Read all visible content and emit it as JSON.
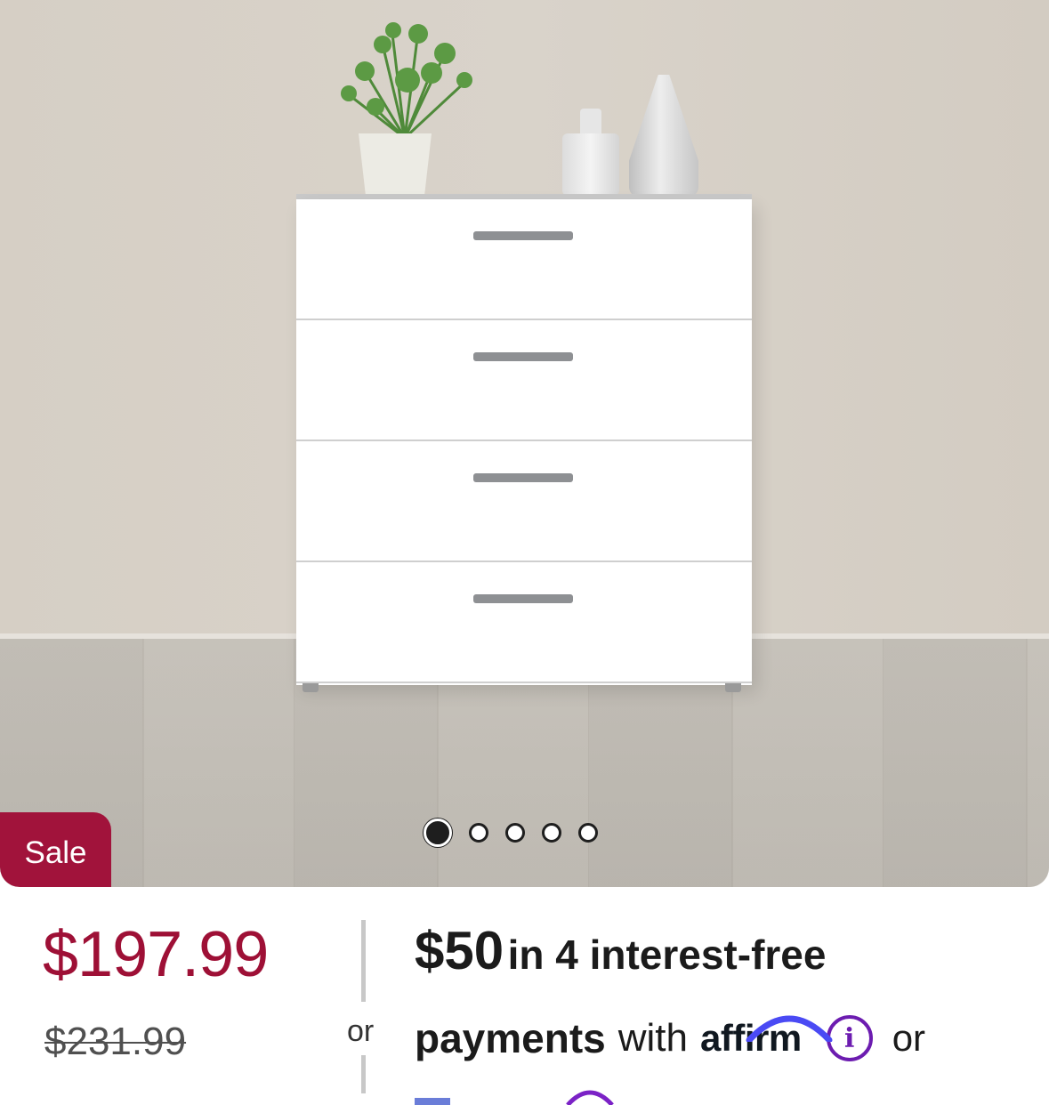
{
  "product": {
    "badge": "Sale",
    "price": "$197.99",
    "original_price": "$231.99"
  },
  "gallery": {
    "total_images": 5,
    "active_index": 0
  },
  "financing": {
    "or_separator": "or",
    "installment_amount": "$50",
    "installment_text": "in 4 interest-free",
    "payments_label": "payments",
    "with_text": "with",
    "provider_logo": "affirm",
    "trailing_or": "or",
    "info_icon": "info-icon"
  },
  "colors": {
    "sale_badge": "#a1133b",
    "price": "#9e1036",
    "info_icon": "#6c1cb0"
  }
}
